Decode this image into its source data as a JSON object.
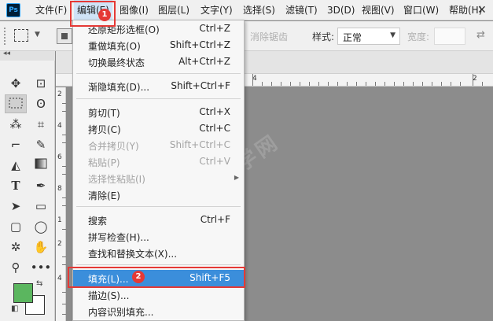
{
  "app": {
    "logo_text": "Ps"
  },
  "menubar": {
    "items": [
      {
        "label": "文件(F)"
      },
      {
        "label": "编辑(E)"
      },
      {
        "label": "图像(I)"
      },
      {
        "label": "图层(L)"
      },
      {
        "label": "文字(Y)"
      },
      {
        "label": "选择(S)"
      },
      {
        "label": "滤镜(T)"
      },
      {
        "label": "3D(D)"
      },
      {
        "label": "视图(V)"
      },
      {
        "label": "窗口(W)"
      },
      {
        "label": "帮助(H)"
      }
    ],
    "active_index": 1
  },
  "options_bar": {
    "antialias_label": "消除锯齿",
    "style_label": "样式:",
    "style_value": "正常",
    "width_label": "宽度:",
    "width_value": ""
  },
  "edit_menu": {
    "items": [
      {
        "label": "还原矩形选框(O)",
        "shortcut": "Ctrl+Z",
        "enabled": true
      },
      {
        "label": "重做填充(O)",
        "shortcut": "Shift+Ctrl+Z",
        "enabled": true
      },
      {
        "label": "切换最终状态",
        "shortcut": "Alt+Ctrl+Z",
        "enabled": true
      },
      {
        "separator": true
      },
      {
        "label": "渐隐填充(D)...",
        "shortcut": "Shift+Ctrl+F",
        "enabled": true
      },
      {
        "separator": true
      },
      {
        "label": "剪切(T)",
        "shortcut": "Ctrl+X",
        "enabled": true
      },
      {
        "label": "拷贝(C)",
        "shortcut": "Ctrl+C",
        "enabled": true
      },
      {
        "label": "合并拷贝(Y)",
        "shortcut": "Shift+Ctrl+C",
        "enabled": false
      },
      {
        "label": "粘贴(P)",
        "shortcut": "Ctrl+V",
        "enabled": false
      },
      {
        "label": "选择性粘贴(I)",
        "shortcut": "",
        "enabled": false,
        "submenu": true
      },
      {
        "label": "清除(E)",
        "shortcut": "",
        "enabled": true
      },
      {
        "separator": true
      },
      {
        "label": "搜索",
        "shortcut": "Ctrl+F",
        "enabled": true
      },
      {
        "label": "拼写检查(H)...",
        "shortcut": "",
        "enabled": true
      },
      {
        "label": "查找和替换文本(X)...",
        "shortcut": "",
        "enabled": true
      },
      {
        "separator": true
      },
      {
        "label": "填充(L)...",
        "shortcut": "Shift+F5",
        "enabled": true,
        "highlighted": true
      },
      {
        "label": "描边(S)...",
        "shortcut": "",
        "enabled": true
      },
      {
        "label": "内容识别填充...",
        "shortcut": "",
        "enabled": true
      }
    ]
  },
  "annotations": {
    "step1": "1",
    "step2": "2",
    "color": "#e53935"
  },
  "ruler": {
    "horizontal_labels": [
      "4",
      "2"
    ],
    "vertical_labels": [
      "2",
      "4",
      "6",
      "8",
      "1",
      "2",
      "4"
    ]
  },
  "colors": {
    "foreground": "#5bb65f",
    "background": "#ffffff",
    "menu_highlight": "#3b8edb"
  },
  "watermark": {
    "text": "软件自学网"
  }
}
